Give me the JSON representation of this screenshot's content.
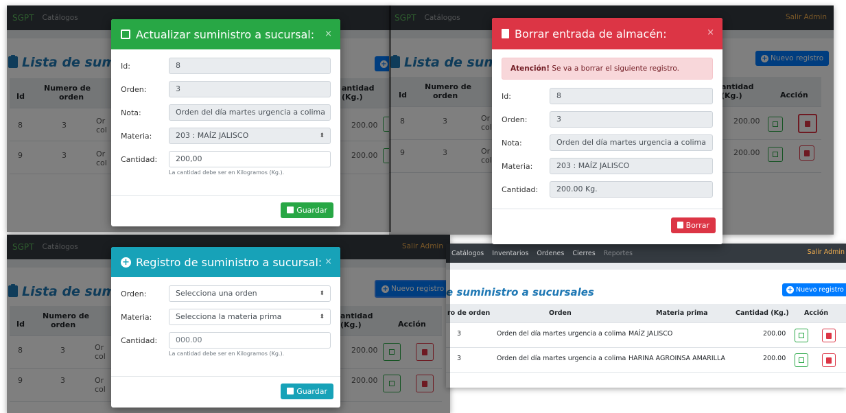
{
  "nav": {
    "brand": "SGPT",
    "catalogos": "Catálogos",
    "inventarios": "Inventarios",
    "ordenes": "Ordenes",
    "cierres": "Cierres",
    "reportes": "Reportes",
    "logout": "Salir Admin"
  },
  "list": {
    "heading_partial": "Lista de sumini",
    "heading_right": "e suministro a sucursales",
    "new_button": "Nuevo registro",
    "columns": {
      "id": "Id",
      "order_number_l1": "Numero de",
      "order_number_l2": "orden",
      "order_number_partial": "ro de orden",
      "order": "Orden",
      "raw_material": "Materia prima",
      "quantity_l1": "antidad",
      "quantity_l2": "(Kg.)",
      "quantity_full": "Cantidad (Kg.)",
      "action": "Acción"
    },
    "rows": [
      {
        "id": "8",
        "order_num": "3",
        "order_cut1": "Or",
        "order_cut2": "col",
        "order": "Orden del día martes urgencia a colima",
        "material": "MAÍZ JALISCO",
        "qty": "200.00"
      },
      {
        "id": "9",
        "order_num": "3",
        "order_cut1": "Or",
        "order_cut2": "col",
        "order": "Orden del día martes urgencia a colima",
        "material": "HARINA AGROINSA AMARILLA",
        "qty": "200.00"
      }
    ]
  },
  "edit_modal": {
    "title": "Actualizar suministro a sucursal:",
    "close": "×",
    "id_label": "Id:",
    "id_value": "8",
    "order_label": "Orden:",
    "order_value": "3",
    "note_label": "Nota:",
    "note_value": "Orden del día martes urgencia a colima",
    "material_label": "Materia:",
    "material_value": "203 : MAÍZ JALISCO",
    "qty_label": "Cantidad:",
    "qty_value": "200,00",
    "help": "La cantidad debe ser en Kilogramos (Kg.).",
    "save": "Guardar"
  },
  "delete_modal": {
    "title": "Borrar entrada de almacén:",
    "close": "×",
    "alert_strong": "Atención!",
    "alert_text": " Se va a borrar el siguiente registro.",
    "id_label": "Id:",
    "id_value": "8",
    "order_label": "Orden:",
    "order_value": "3",
    "note_label": "Nota:",
    "note_value": "Orden del día martes urgencia a colima",
    "material_label": "Materia:",
    "material_value": "203 : MAÍZ JALISCO",
    "qty_label": "Cantidad:",
    "qty_value": "200.00 Kg.",
    "delete": "Borrar"
  },
  "new_modal": {
    "title": "Registro de suministro a sucursal:",
    "close": "×",
    "order_label": "Orden:",
    "order_placeholder": "Selecciona una orden",
    "material_label": "Materia:",
    "material_placeholder": "Selecciona la materia prima",
    "qty_label": "Cantidad:",
    "qty_placeholder": "000.00",
    "help": "La cantidad debe ser en Kilogramos (Kg.).",
    "save": "Guardar"
  },
  "colors": {
    "success": "#28a745",
    "danger": "#dc3545",
    "info": "#17a2b8",
    "primary": "#007bff",
    "navbar": "#343a40"
  }
}
